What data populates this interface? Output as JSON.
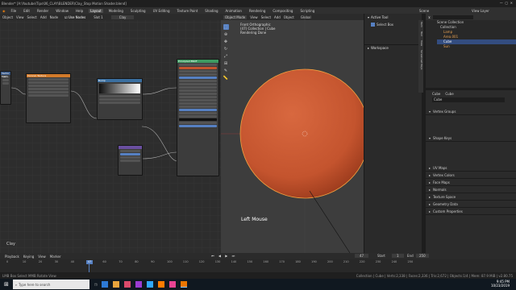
{
  "title": "Blender* [A:\\Youtube\\Tips\\06_CLAY\\BLENDER\\Clay_Stop Motion Shader.blend]",
  "menu": [
    "File",
    "Edit",
    "Render",
    "Window",
    "Help"
  ],
  "workspace_tabs": [
    "Layout",
    "Modeling",
    "Sculpting",
    "UV Editing",
    "Texture Paint",
    "Shading",
    "Animation",
    "Rendering",
    "Compositing",
    "Scripting"
  ],
  "scene_label": "Scene",
  "view_layer_label": "View Layer",
  "node_editor": {
    "header": [
      "Object",
      "View",
      "Select",
      "Add",
      "Node"
    ],
    "use_nodes": "Use Nodes",
    "slot": "Slot 1",
    "material": "Clay",
    "footer_label": "Clay",
    "nodes": {
      "vector": "Vector Math",
      "voronoi": "Voronoi Texture",
      "bump": "Bump",
      "principled": "Principled BSDF"
    },
    "socket_labels": [
      "Base Color",
      "Subsurface",
      "Metallic",
      "Specular",
      "Roughness",
      "Normal"
    ]
  },
  "viewport": {
    "header": [
      "Object Mode",
      "View",
      "Select",
      "Add",
      "Object"
    ],
    "transform": "Global",
    "overlay_lines": [
      "Front Orthographic",
      "(47) Collection | Cube",
      "Rendering Done"
    ],
    "mouse_hint": "Left Mouse",
    "colors": {
      "sphere": "#c4542e",
      "bg": "#3d3d3d"
    }
  },
  "npanel": {
    "active_tool": "Active Tool",
    "select_box": "Select Box",
    "workspace": "Workspace",
    "tabs": [
      "Item",
      "Tool",
      "View",
      "Screencast Keys"
    ]
  },
  "outliner": {
    "title": "Scene Collection",
    "items": [
      "Collection",
      "Lamp",
      "Area.001",
      "Cube",
      "Sun"
    ]
  },
  "properties": {
    "object": "Cube",
    "mesh": "Cube",
    "mesh_name": "Cube",
    "sections": [
      "Vertex Groups",
      "Shape Keys",
      "UV Maps",
      "Vertex Colors",
      "Face Maps",
      "Normals",
      "Texture Space",
      "Geometry Data",
      "Custom Properties"
    ]
  },
  "timeline": {
    "menus": [
      "Playback",
      "Keying",
      "View",
      "Marker"
    ],
    "current_frame": "47",
    "start_label": "Start",
    "start": "1",
    "end_label": "End",
    "end": "250",
    "ticks": [
      "0",
      "10",
      "20",
      "30",
      "40",
      "50",
      "60",
      "70",
      "80",
      "90",
      "100",
      "110",
      "120",
      "130",
      "140",
      "150",
      "160",
      "170",
      "180",
      "190",
      "200",
      "210",
      "220",
      "230",
      "240",
      "250"
    ]
  },
  "status": {
    "left": "LMB  Box Select  MMB  Rotate View",
    "right": "Collection | Cube | Verts:2,338 | Faces:2,336 | Tris:2,672 | Objects:1/4 | Mem: 87.9 MiB | v2.80.75"
  },
  "taskbar": {
    "search": "Type here to search",
    "time": "9:45 PM",
    "date": "10/23/2019"
  }
}
